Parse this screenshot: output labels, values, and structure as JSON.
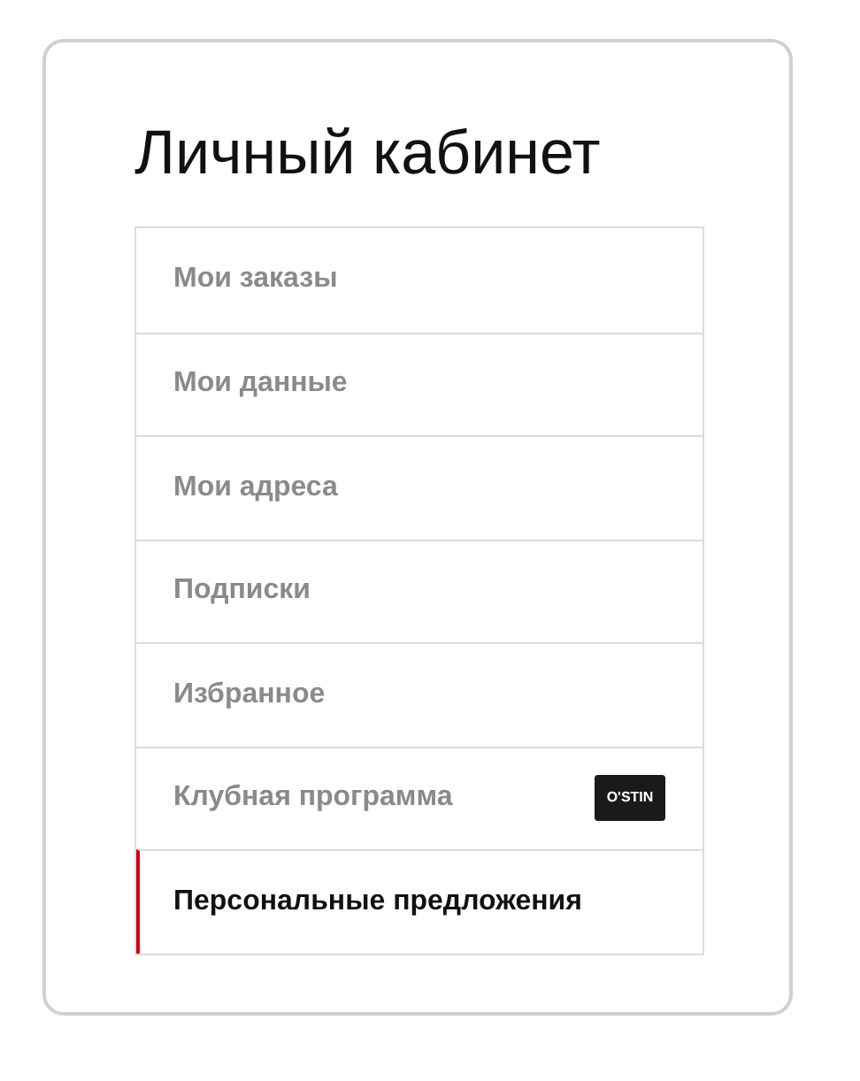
{
  "title": "Личный кабинет",
  "menu": [
    {
      "label": "Мои заказы",
      "selected": false
    },
    {
      "label": "Мои данные",
      "selected": false
    },
    {
      "label": "Мои адреса",
      "selected": false
    },
    {
      "label": "Подписки",
      "selected": false
    },
    {
      "label": "Избранное",
      "selected": false
    },
    {
      "label": "Клубная программа",
      "selected": false,
      "badge": "O'STIN"
    },
    {
      "label": "Персональные предложения",
      "selected": true
    }
  ]
}
